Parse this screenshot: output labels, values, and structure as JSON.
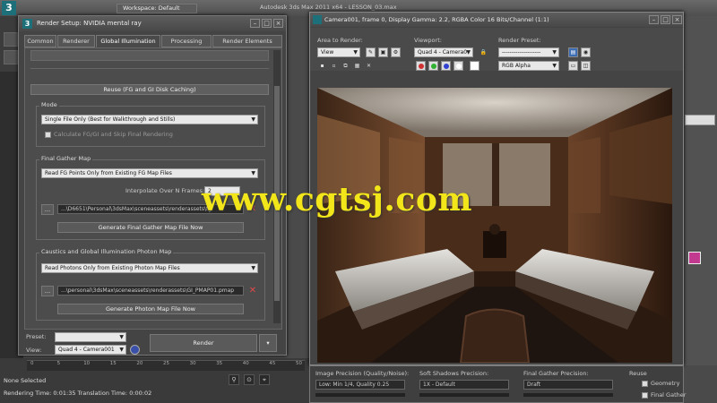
{
  "app": {
    "workspace": "Workspace: Default",
    "title": "Autodesk 3ds Max 2011 x64 - LESSON_03.max",
    "status_selected": "None Selected",
    "status_time": "Rendering Time: 0:01:35   Translation Time: 0:00:02",
    "timeline_ticks": [
      "0",
      "5",
      "10",
      "15",
      "20",
      "25",
      "30",
      "35",
      "40",
      "45",
      "50"
    ]
  },
  "render_setup": {
    "title": "Render Setup: NVIDIA mental ray",
    "tabs": [
      "Common",
      "Renderer",
      "Global Illumination",
      "Processing",
      "Render Elements"
    ],
    "active_tab": "Global Illumination",
    "rollout_title": "Reuse (FG and GI Disk Caching)",
    "mode": {
      "label": "Mode",
      "selected": "Single File Only (Best for Walkthrough and Stills)",
      "checkbox_label": "Calculate FG/GI and Skip Final Rendering"
    },
    "final_gather_map": {
      "label": "Final Gather Map",
      "selected": "Read FG Points Only from Existing FG Map Files",
      "interpolate_label": "Interpolate Over N Frames:",
      "interpolate_value": "2",
      "path": "...\\D6651\\Personal\\3dsMax\\sceneassets\\renderassets\\fg",
      "generate_button": "Generate Final Gather Map File Now"
    },
    "photon_map": {
      "label": "Caustics and Global Illumination Photon Map",
      "selected": "Read Photons Only from Existing Photon Map Files",
      "path": "...\\personal\\3dsMax\\sceneassets\\renderassets\\GI_PMAP01.pmap",
      "generate_button": "Generate Photon Map File Now"
    },
    "footer": {
      "preset_label": "Preset:",
      "preset_value": "",
      "view_label": "View:",
      "view_value": "Quad 4 - Camera001",
      "render_button": "Render"
    }
  },
  "frame_buffer": {
    "title": "Camera001, frame 0, Display Gamma: 2.2, RGBA Color 16 Bits/Channel (1:1)",
    "area_label": "Area to Render:",
    "area_value": "View",
    "viewport_label": "Viewport:",
    "viewport_value": "Quad 4 - Camera0",
    "presets_label": "Render Preset:",
    "presets_value": "--------------------",
    "channel_value": "RGB Alpha",
    "render_button": "Render"
  },
  "bottom_panel": {
    "image_precision_label": "Image Precision (Quality/Noise):",
    "image_precision_value": "Low: Min 1/4, Quality 0.25",
    "soft_shadows_label": "Soft Shadows Precision:",
    "soft_shadows_value": "1X - Default",
    "fg_precision_label": "Final Gather Precision:",
    "fg_precision_value": "Draft",
    "reuse_label": "Reuse",
    "reuse_geometry": "Geometry",
    "reuse_fg": "Final Gather"
  },
  "watermark": "www.cgtsj.com",
  "colors": {
    "watermark": "#f2e61a",
    "close_red": "#e04848",
    "accent_swatch": "#c23a8f"
  }
}
